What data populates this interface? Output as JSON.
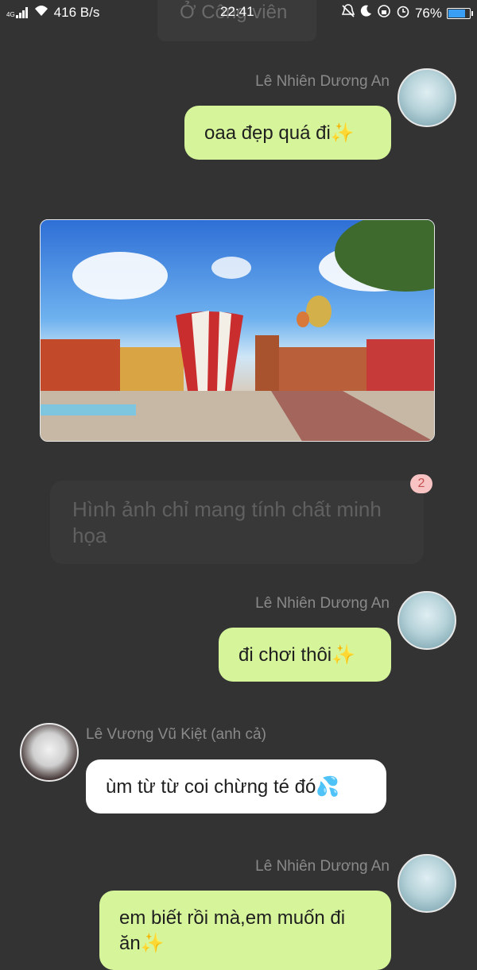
{
  "status_bar": {
    "network": "4G",
    "speed": "416 B/s",
    "time": "22:41",
    "battery": "76%",
    "battery_level": 0.76,
    "icons": [
      "signal-icon",
      "wifi-icon",
      "bell-off-icon",
      "moon-icon",
      "rotation-lock-icon",
      "alarm-icon",
      "battery-icon"
    ]
  },
  "header": {
    "title": "Ở Công viên"
  },
  "messages": [
    {
      "sender": "Lê Nhiên Dương An",
      "text": "oaa đẹp quá đi✨"
    },
    {
      "image_alt": "amusement-park-image"
    },
    {
      "notice": "Hình ảnh chỉ mang tính chất minh họa",
      "badge": "2"
    },
    {
      "sender": "Lê Nhiên Dương An",
      "text": "đi chơi thôi✨"
    },
    {
      "sender": "Lê Vương Vũ Kiệt (anh cả)",
      "text": "ùm từ từ coi chừng té đó💦"
    },
    {
      "sender": "Lê Nhiên Dương An",
      "text": "em biết rồi mà,em muốn đi ăn✨"
    }
  ],
  "colors": {
    "background": "#333333",
    "outgoing_bubble": "#d6f59a",
    "incoming_bubble": "#ffffff",
    "battery_fill": "#3b9ef5"
  }
}
